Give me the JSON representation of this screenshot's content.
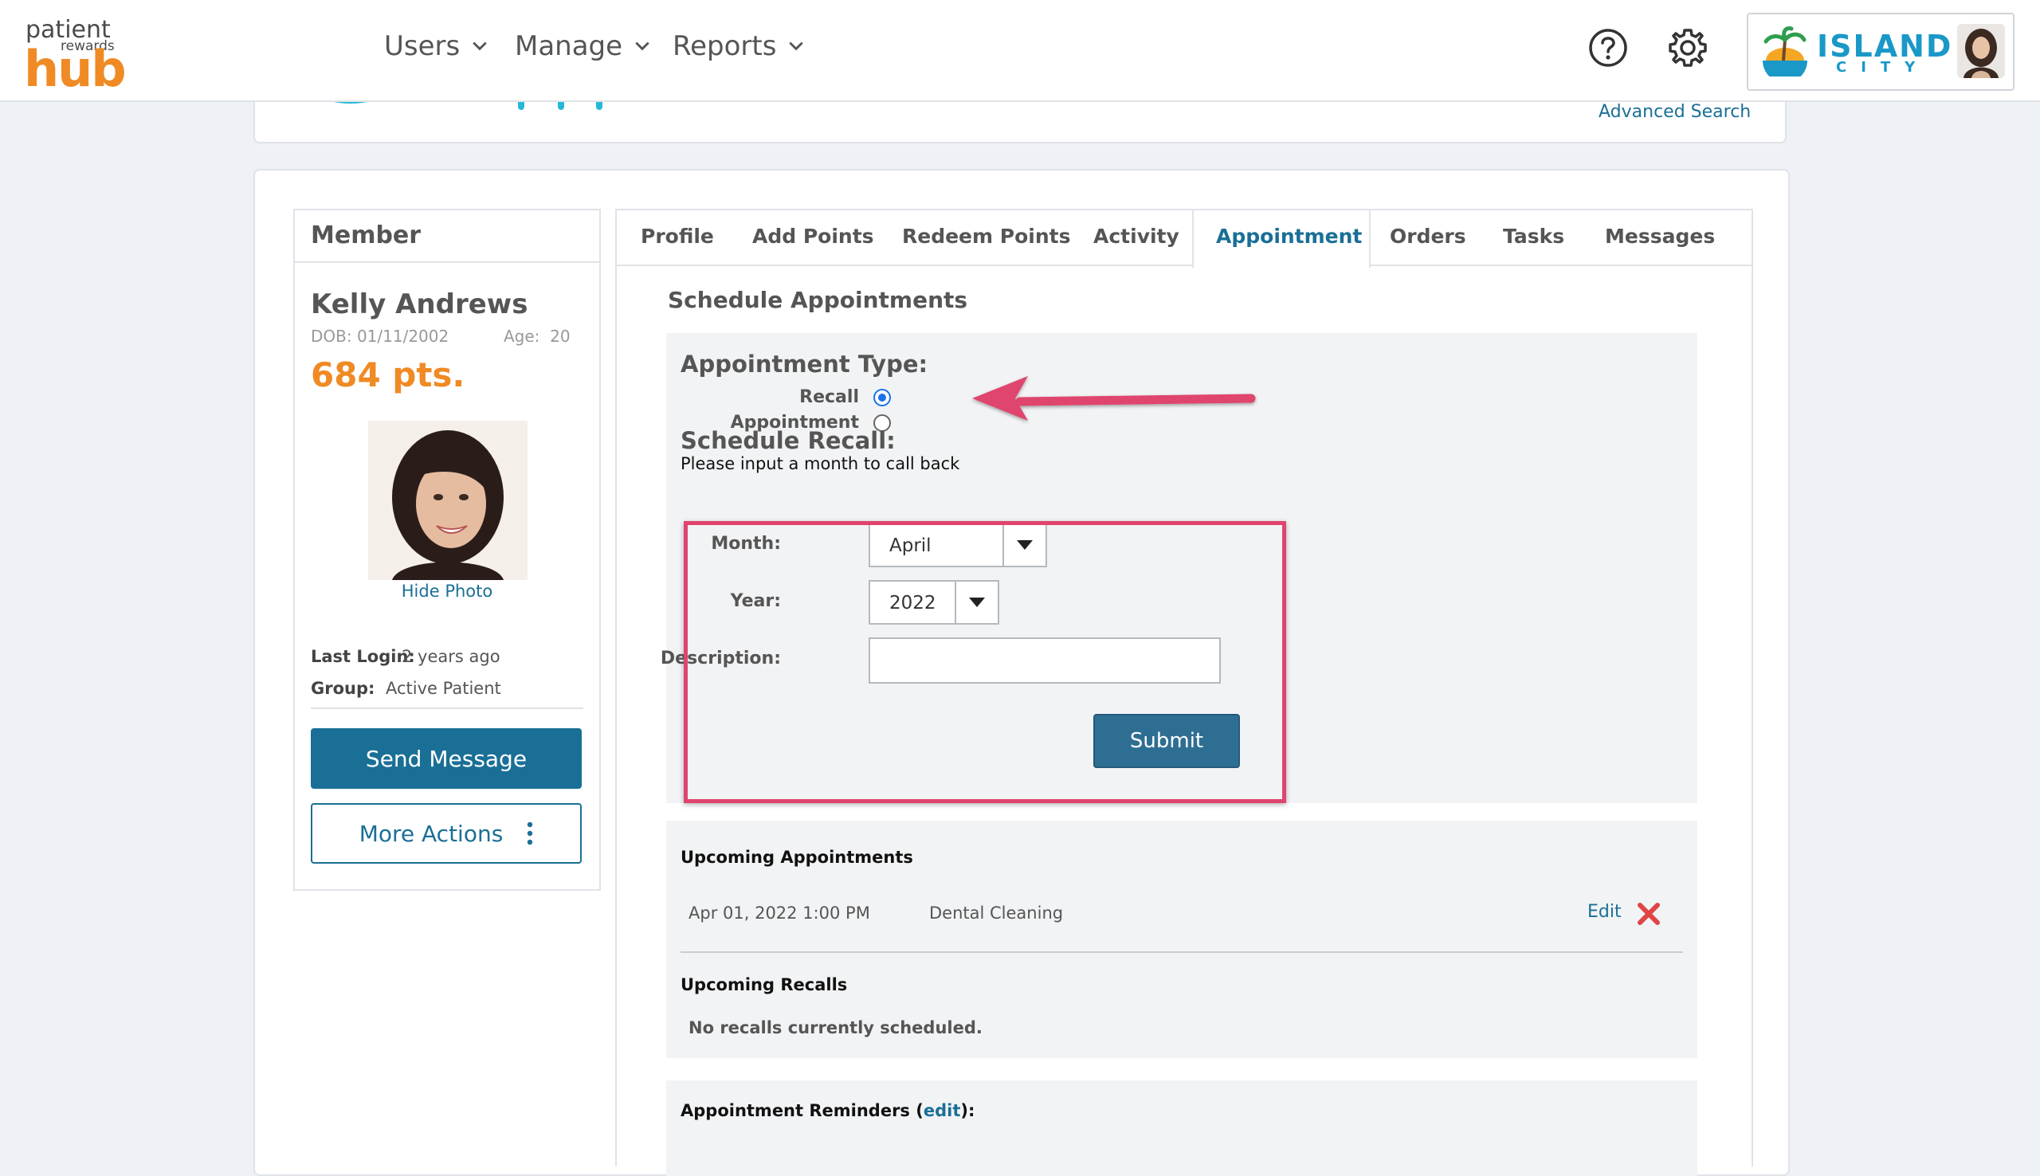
{
  "header": {
    "logo": {
      "line1": "patient",
      "line2": "rewards",
      "line3": "hub"
    },
    "nav": [
      {
        "label": "Users"
      },
      {
        "label": "Manage"
      },
      {
        "label": "Reports"
      }
    ],
    "brand": {
      "name": "ISLAND",
      "sub": "CITY"
    }
  },
  "search": {
    "advanced_label": "Advanced Search"
  },
  "member": {
    "title": "Member",
    "name": "Kelly Andrews",
    "dob": "DOB: 01/11/2002",
    "age_label": "Age:",
    "age_value": "20",
    "points": "684 pts.",
    "hide_photo": "Hide Photo",
    "last_login_label": "Last Login:",
    "last_login_value": "2 years ago",
    "group_label": "Group:",
    "group_value": "Active Patient",
    "send_message": "Send Message",
    "more_actions": "More Actions"
  },
  "tabs": [
    {
      "label": "Profile"
    },
    {
      "label": "Add Points"
    },
    {
      "label": "Redeem Points"
    },
    {
      "label": "Activity"
    },
    {
      "label": "Appointment"
    },
    {
      "label": "Orders"
    },
    {
      "label": "Tasks"
    },
    {
      "label": "Messages"
    }
  ],
  "active_tab": "Appointment",
  "schedule": {
    "title": "Schedule Appointments",
    "appointment_type_label": "Appointment Type:",
    "radio_recall": "Recall",
    "radio_appointment": "Appointment",
    "selected_type": "Recall",
    "schedule_recall_label": "Schedule Recall:",
    "hint": "Please input a month to call back",
    "month_label": "Month:",
    "month_value": "April",
    "year_label": "Year:",
    "year_value": "2022",
    "description_label": "Description:",
    "description_value": "",
    "submit": "Submit"
  },
  "upcoming": {
    "appointments_title": "Upcoming Appointments",
    "appointments": [
      {
        "datetime": "Apr 01, 2022 1:00 PM",
        "description": "Dental Cleaning",
        "edit": "Edit"
      }
    ],
    "recalls_title": "Upcoming Recalls",
    "recalls_empty": "No recalls currently scheduled."
  },
  "reminders": {
    "title": "Appointment Reminders (",
    "edit": "edit",
    "title_end": "):"
  },
  "colors": {
    "accent": "#1a6f96",
    "points": "#f08a24",
    "annotation": "#e0446e",
    "brand": "#1a98c8"
  }
}
